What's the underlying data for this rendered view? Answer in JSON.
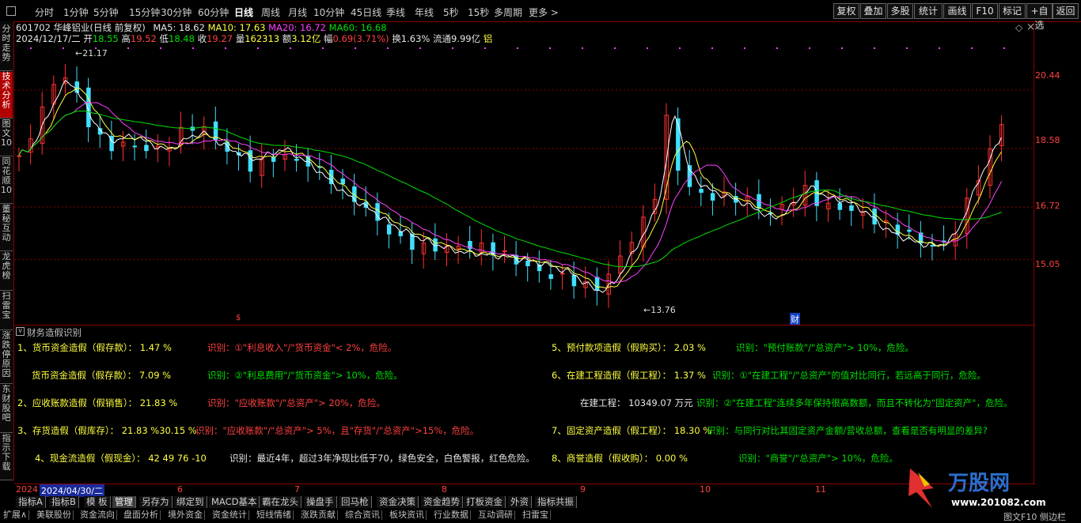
{
  "toolbar": {
    "periods": [
      "分时",
      "1分钟",
      "5分钟",
      "15分钟",
      "30分钟",
      "60分钟",
      "日线",
      "周线",
      "月线",
      "10分钟",
      "45日线",
      "季线",
      "年线",
      "5秒",
      "15秒",
      "多周期",
      "更多 >"
    ],
    "active_period": "日线",
    "right_buttons": [
      "复权",
      "叠加",
      "多股",
      "统计",
      "画线",
      "F10",
      "标记",
      "+自选",
      "返回"
    ]
  },
  "left_tabs": [
    "分时走势",
    "技术分析",
    "图文10",
    "同花顺10",
    "董秘互动",
    "龙虎榜",
    "扫雷宝",
    "涨跌停原因",
    "东财股吧",
    "指示下载"
  ],
  "active_left_tab": "技术分析",
  "stock": {
    "code": "601702",
    "name": "华峰铝业(日线 前复权)",
    "ma5_label": "MA5: 18.62",
    "ma10_label": "MA10: 17.63",
    "ma20_label": "MA20: 16.72",
    "ma60_label": "MA60: 16.68",
    "date": "2024/12/17/二",
    "open_label": "开",
    "open": "18.55",
    "high_label": "高",
    "high": "19.52",
    "low_label": "低",
    "low": "18.48",
    "close_label": "收",
    "close": "19.27",
    "vol_label": "量",
    "vol": "162313",
    "amount_label": "额",
    "amount": "3.12亿",
    "change_label": "幅",
    "change": "0.69(3.71%)",
    "turnover": "换1.63%",
    "float": "流通9.99亿",
    "tag": "铝"
  },
  "price_axis": [
    "20.44",
    "18.58",
    "16.72",
    "15.05"
  ],
  "price_marks": {
    "max_label": "21.17",
    "min_label": "13.76",
    "event_left": "$",
    "event_right": "财"
  },
  "panel": {
    "title": "财务造假识别",
    "lines": [
      {
        "text": "1、货币资金造假（假存款）： 1.47 %",
        "color": "#ffff40"
      },
      {
        "text": "识别：①\"利息收入\"/\"货币资金\"< 2%，危险。",
        "color": "#ff4040"
      },
      {
        "text": "5、预付款项造假（假购买）： 2.03 %",
        "color": "#ffff40"
      },
      {
        "text": "识别：\"预付账款\"/\"总资产\"> 10%，危险。",
        "color": "#00e000"
      },
      {
        "text": "货币资金造假（假存款）： 7.09 %",
        "color": "#ffff40"
      },
      {
        "text": "识别：②\"利息费用\"/\"货币资金\"> 10%，危险。",
        "color": "#00e000"
      },
      {
        "text": "6、在建工程造假（假工程）： 1.37 %",
        "color": "#ffff40"
      },
      {
        "text": "识别：①\"在建工程\"/\"总资产\"的值对比同行，若远高于同行，危险。",
        "color": "#00e000"
      },
      {
        "text": "2、应收账款造假（假销售）： 21.83 %",
        "color": "#ffff40"
      },
      {
        "text": "识别：\"应收账款\"/\"总资产\"> 20%，危险。",
        "color": "#ff4040"
      },
      {
        "text": "在建工程： 10349.07 万元",
        "color": "#e6e6e6"
      },
      {
        "text": "识别：②\"在建工程\"连续多年保持很高数额，而且不转化为\"固定资产\"，危险。",
        "color": "#00e000"
      },
      {
        "text": "3、存货造假（假库存）： 21.83 %30.15 %",
        "color": "#ffff40"
      },
      {
        "text": "识别：\"应收账款\"/\"总资产\"> 5%，且\"存货\"/\"总资产\">15%，危险。",
        "color": "#ff4040"
      },
      {
        "text": "7、固定资产造假（假工程）： 18.30 %",
        "color": "#ffff40"
      },
      {
        "text": "识别：与同行对比其固定资产金额/营收总额，查看是否有明显的差异?",
        "color": "#00e000"
      },
      {
        "text": "4、现金流造假（假现金）： 42 49 76 -10",
        "color": "#ffff40"
      },
      {
        "text": "识别：最近4年，超过3年净现比低于70，绿色安全，白色警报，红色危险。",
        "color": "#e6e6e6"
      },
      {
        "text": "8、商誉造假（假收购）： 0.00 %",
        "color": "#ffff40"
      },
      {
        "text": "识别：\"商誉\"/\"总资产\"> 10%，危险。",
        "color": "#00e000"
      }
    ]
  },
  "date_axis": {
    "start": "2024",
    "cursor": "2024/04/30/二",
    "months": [
      "6",
      "7",
      "8",
      "9",
      "10",
      "11"
    ]
  },
  "bottom_tabs": [
    "指标A",
    "指标B",
    "模 板",
    "管理",
    "另存为",
    "绑定到",
    "MACD基本",
    "霸在龙头",
    "操盘手",
    "回马枪",
    "资金决策",
    "资金趋势",
    "打板资金",
    "外资",
    "指标共振"
  ],
  "active_bottom_tab": "管理",
  "bottom_tabs2": [
    "扩展∧",
    "美联股份",
    "资金流向",
    "盘面分析",
    "境外资金",
    "资金统计",
    "短线情绪",
    "涨跌贡献",
    "综合资讯",
    "板块资讯",
    "行业数据",
    "互动调研",
    "扫雷宝"
  ],
  "bottom_right": "图文F10 侧边栏",
  "watermark": "万股网 www.201082.com",
  "colors": {
    "up": "#ff3030",
    "down": "#40e0ff",
    "ma5": "#ffffff",
    "ma10": "#ffff40",
    "ma20": "#ff40ff",
    "ma60": "#00e000",
    "frame": "#8b0000"
  }
}
